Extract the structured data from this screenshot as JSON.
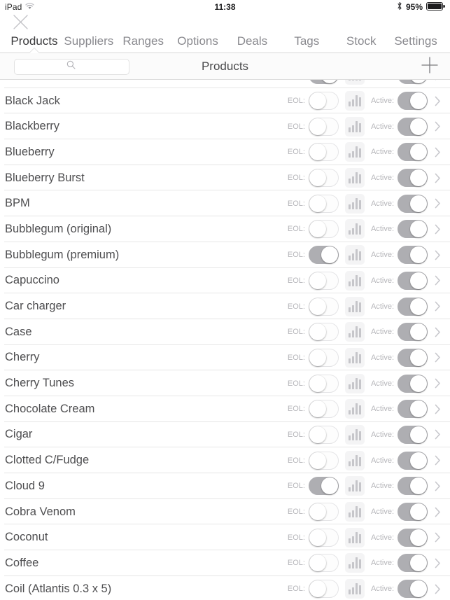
{
  "status_bar": {
    "device": "iPad",
    "wifi_icon": "wifi-icon",
    "time": "11:38",
    "bluetooth_icon": "bluetooth-icon",
    "battery_percent": "95%",
    "battery_icon": "battery-icon"
  },
  "close_button": {
    "icon": "close-x-icon",
    "label": ""
  },
  "tabs": [
    {
      "label": "Products",
      "active": true
    },
    {
      "label": "Suppliers",
      "active": false
    },
    {
      "label": "Ranges",
      "active": false
    },
    {
      "label": "Options",
      "active": false
    },
    {
      "label": "Deals",
      "active": false
    },
    {
      "label": "Tags",
      "active": false
    },
    {
      "label": "Stock",
      "active": false
    },
    {
      "label": "Settings",
      "active": false
    }
  ],
  "nav_bar": {
    "title": "Products",
    "search_placeholder": "",
    "search_value": "",
    "search_icon": "search-icon",
    "add_icon": "plus-icon"
  },
  "row_labels": {
    "eol": "EOL:",
    "active": "Active:"
  },
  "colors": {
    "toggle_on_track": "#aeaeb2",
    "toggle_off_track": "#fdfdfd",
    "text_primary": "#4e4e50",
    "text_muted": "#b6b6ba",
    "tab_active": "#3a3a3c",
    "tab_inactive": "#8a8a8f",
    "separator": "#e6e6e6",
    "chart_icon_bg": "#f4f4f5",
    "chart_icon_bar": "#c6c6ca"
  },
  "products": [
    {
      "name": "",
      "eol": true,
      "active": true,
      "partial": true
    },
    {
      "name": "Black Jack",
      "eol": false,
      "active": true
    },
    {
      "name": "Blackberry",
      "eol": false,
      "active": true
    },
    {
      "name": "Blueberry",
      "eol": false,
      "active": true
    },
    {
      "name": "Blueberry Burst",
      "eol": false,
      "active": true
    },
    {
      "name": "BPM",
      "eol": false,
      "active": true
    },
    {
      "name": "Bubblegum (original)",
      "eol": false,
      "active": true
    },
    {
      "name": "Bubblegum (premium)",
      "eol": true,
      "active": true
    },
    {
      "name": "Capuccino",
      "eol": false,
      "active": true
    },
    {
      "name": "Car charger",
      "eol": false,
      "active": true
    },
    {
      "name": "Case",
      "eol": false,
      "active": true
    },
    {
      "name": "Cherry",
      "eol": false,
      "active": true
    },
    {
      "name": "Cherry Tunes",
      "eol": false,
      "active": true
    },
    {
      "name": "Chocolate Cream",
      "eol": false,
      "active": true
    },
    {
      "name": "Cigar",
      "eol": false,
      "active": true
    },
    {
      "name": "Clotted C/Fudge",
      "eol": false,
      "active": true
    },
    {
      "name": "Cloud 9",
      "eol": true,
      "active": true
    },
    {
      "name": "Cobra Venom",
      "eol": false,
      "active": true
    },
    {
      "name": "Coconut",
      "eol": false,
      "active": true
    },
    {
      "name": "Coffee",
      "eol": false,
      "active": true
    },
    {
      "name": "Coil (Atlantis 0.3 x 5)",
      "eol": false,
      "active": true
    }
  ]
}
